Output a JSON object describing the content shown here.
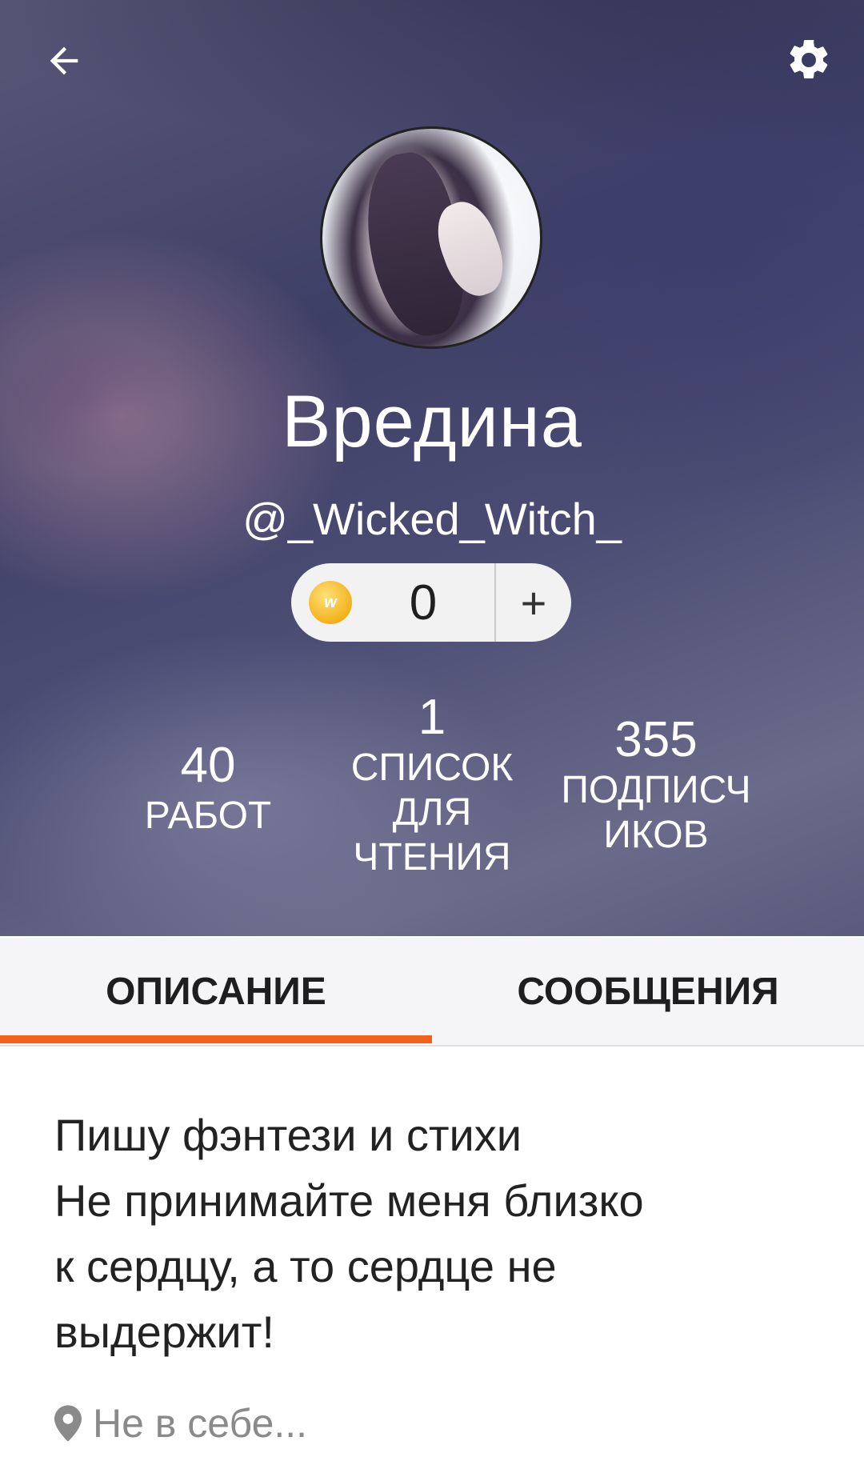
{
  "header": {
    "back_icon": "arrow-left-icon",
    "settings_icon": "gear-icon"
  },
  "profile": {
    "display_name": "Вредина",
    "username": "@_Wicked_Witch_"
  },
  "coins": {
    "icon": "wattpad-coin-icon",
    "count": "0",
    "add_label": "+"
  },
  "stats": {
    "works": {
      "value": "40",
      "label": "РАБОТ"
    },
    "reading_lists": {
      "value": "1",
      "label_lines": [
        "СПИСОК",
        "ДЛЯ",
        "ЧТЕНИЯ"
      ]
    },
    "followers": {
      "value": "355",
      "label_lines": [
        "ПОДПИСЧ",
        "ИКОВ"
      ]
    }
  },
  "tabs": [
    {
      "label": "ОПИСАНИЕ",
      "active": true
    },
    {
      "label": "СООБЩЕНИЯ",
      "active": false
    }
  ],
  "accent_color": "#f2621c",
  "description_lines": [
    "Пишу фэнтези и стихи",
    "Не принимайте меня близко",
    "к сердцу, а то сердце не",
    "выдержит!"
  ],
  "location": {
    "icon": "location-pin-icon",
    "text": "Не в себе..."
  }
}
